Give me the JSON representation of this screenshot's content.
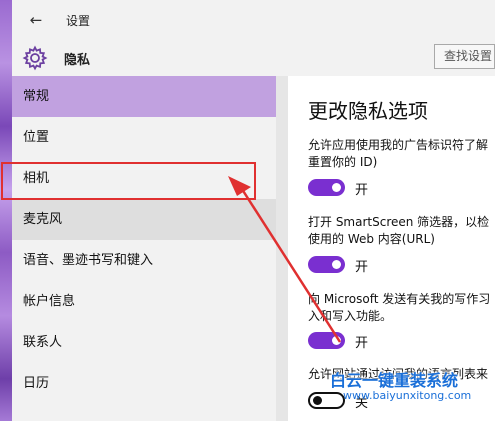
{
  "window": {
    "title": "设置",
    "back_icon": "←"
  },
  "header": {
    "title": "隐私",
    "search_placeholder": "查找设置"
  },
  "sidebar": {
    "items": [
      {
        "label": "常规",
        "state": "active"
      },
      {
        "label": "位置",
        "state": "normal"
      },
      {
        "label": "相机",
        "state": "normal"
      },
      {
        "label": "麦克风",
        "state": "hover"
      },
      {
        "label": "语音、墨迹书写和键入",
        "state": "normal"
      },
      {
        "label": "帐户信息",
        "state": "normal"
      },
      {
        "label": "联系人",
        "state": "normal"
      },
      {
        "label": "日历",
        "state": "normal"
      }
    ]
  },
  "main": {
    "title": "更改隐私选项",
    "settings": [
      {
        "desc_line1": "允许应用使用我的广告标识符了解",
        "desc_line2": "重置你的 ID)",
        "toggle": "on",
        "toggle_label": "开"
      },
      {
        "desc_line1": "打开 SmartScreen 筛选器，以检",
        "desc_line2": "使用的 Web 内容(URL)",
        "toggle": "on",
        "toggle_label": "开"
      },
      {
        "desc_line1": "向 Microsoft 发送有关我的写作习",
        "desc_line2": "入和写入功能。",
        "toggle": "on",
        "toggle_label": "开"
      },
      {
        "desc_line1": "允许网站通过访问我的语言列表来",
        "toggle": "off",
        "toggle_label": "关"
      }
    ]
  },
  "watermark": {
    "text": "白云一键重装系统",
    "url": "www.baiyunxitong.com"
  },
  "colors": {
    "accent": "#7a2fd0",
    "nav_active": "#c1a1e0",
    "annotation": "#e03030",
    "watermark": "#1a6fd8"
  }
}
